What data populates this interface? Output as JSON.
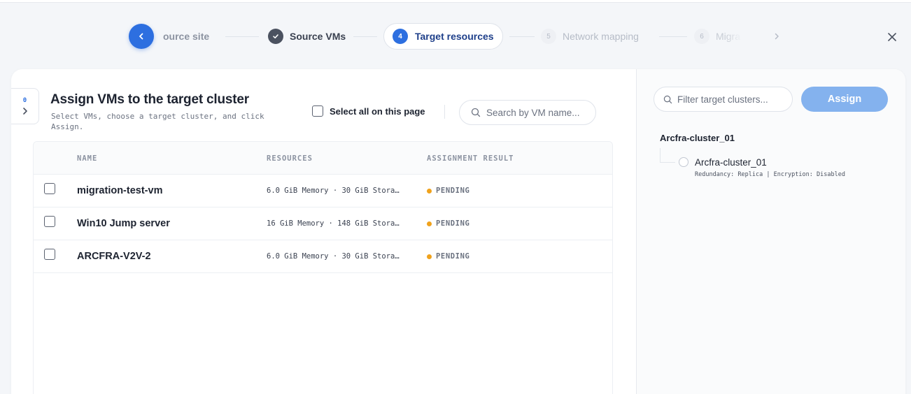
{
  "stepper": {
    "steps": [
      {
        "label": "ource site",
        "state": "done"
      },
      {
        "label": "Source VMs",
        "state": "done"
      },
      {
        "number": "4",
        "label": "Target resources",
        "state": "active"
      },
      {
        "number": "5",
        "label": "Network mapping",
        "state": "upcoming"
      },
      {
        "number": "6",
        "label": "Migra",
        "state": "upcoming"
      }
    ]
  },
  "sidebar_toggle": {
    "count": "0"
  },
  "main": {
    "title": "Assign VMs to the target cluster",
    "subtitle": "Select VMs, choose a target cluster, and click Assign.",
    "select_all_label": "Select all on this page",
    "search_placeholder": "Search by VM name..."
  },
  "table": {
    "columns": [
      "NAME",
      "RESOURCES",
      "ASSIGNMENT RESULT"
    ],
    "rows": [
      {
        "name": "migration-test-vm",
        "resources": "6.0 GiB Memory · 30 GiB Stora…",
        "status": "PENDING"
      },
      {
        "name": "Win10 Jump server",
        "resources": "16 GiB Memory · 148 GiB Stora…",
        "status": "PENDING"
      },
      {
        "name": "ARCFRA-V2V-2",
        "resources": "6.0 GiB Memory · 30 GiB Stora…",
        "status": "PENDING"
      }
    ]
  },
  "right_panel": {
    "filter_placeholder": "Filter target clusters...",
    "assign_label": "Assign",
    "group_name": "Arcfra-cluster_01",
    "clusters": [
      {
        "name": "Arcfra-cluster_01",
        "meta": "Redundancy: Replica | Encryption: Disabled"
      }
    ]
  },
  "colors": {
    "primary": "#2d6fe0",
    "assign_disabled": "#84b2ee",
    "pending": "#f0a21c"
  }
}
